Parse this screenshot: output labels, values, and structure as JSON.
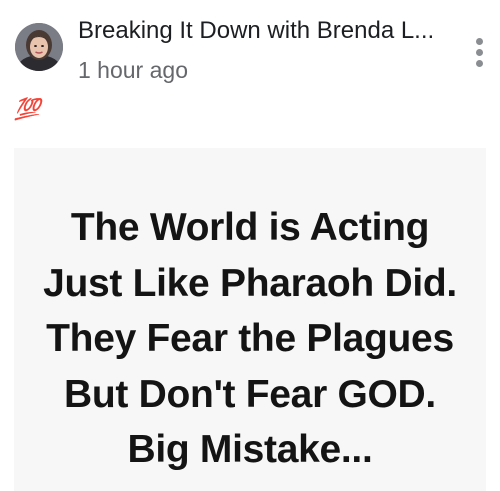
{
  "post": {
    "author_name": "Breaking It Down with Brenda L...",
    "timestamp": "1 hour ago",
    "more_icon": "more-vertical-icon",
    "reaction_emoji": "💯",
    "reaction_emoji_name": "hundred-points-emoji",
    "image": {
      "lines": [
        "The World is Acting",
        "Just Like Pharaoh Did.",
        "They Fear the Plagues",
        "But Don't Fear GOD.",
        "Big Mistake..."
      ]
    }
  },
  "colors": {
    "author_text": "#1c1e21",
    "timestamp_text": "#65676b",
    "emoji_red": "#e41e3f",
    "image_background": "#f7f7f7",
    "quote_text": "#141414"
  }
}
